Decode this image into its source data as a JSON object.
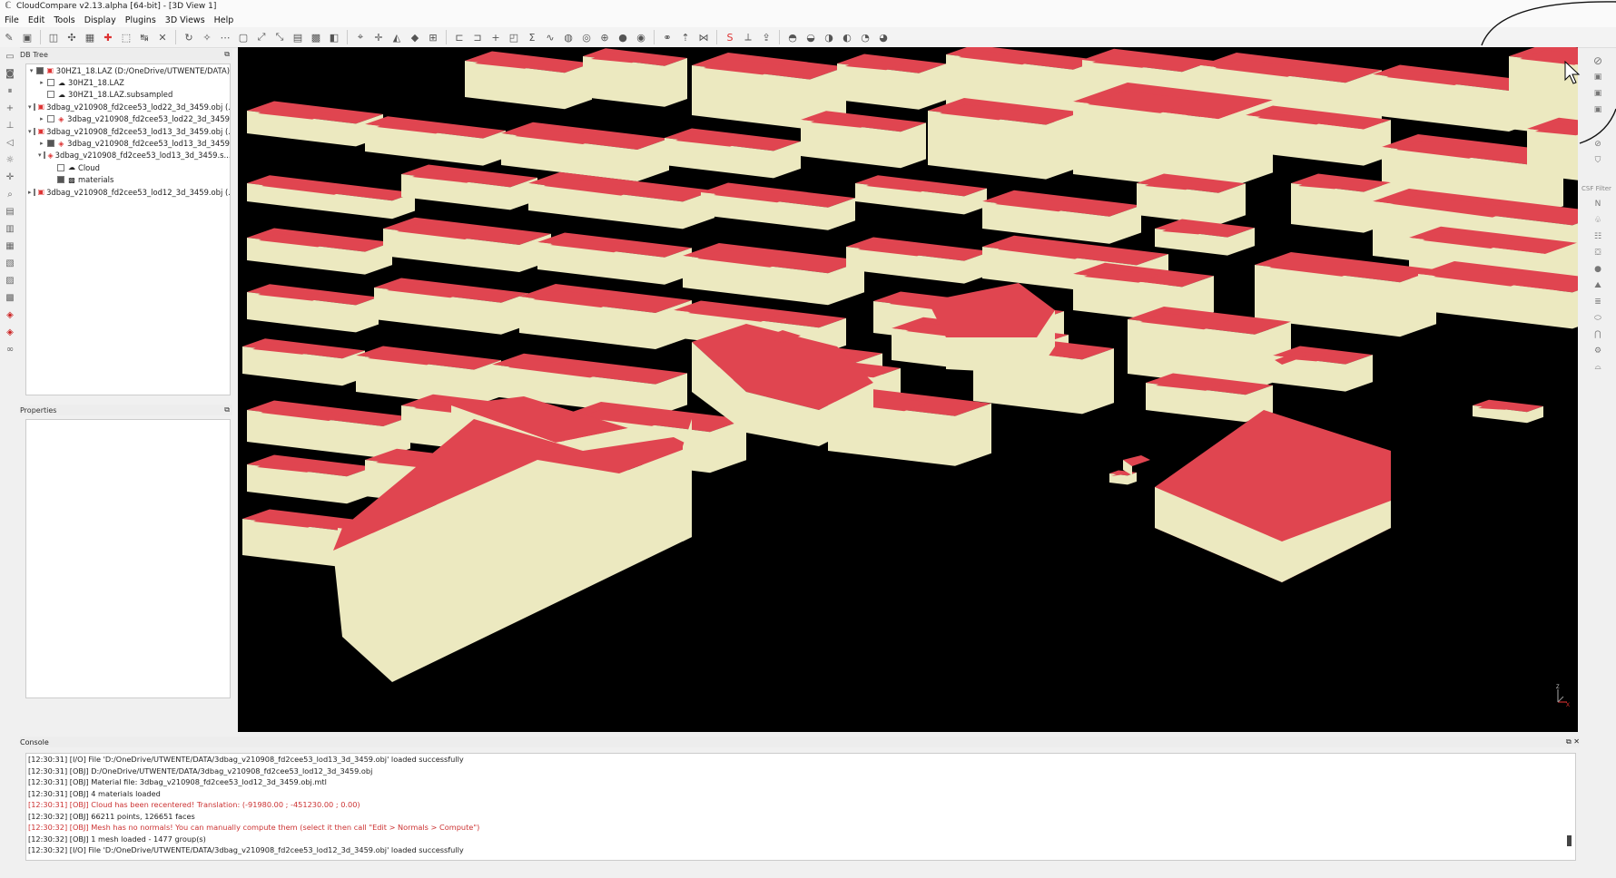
{
  "title": "CloudCompare v2.13.alpha [64-bit] - [3D View 1]",
  "menu": [
    "File",
    "Edit",
    "Tools",
    "Display",
    "Plugins",
    "3D Views",
    "Help"
  ],
  "panels": {
    "dbtree_title": "DB Tree",
    "properties_title": "Properties",
    "console_title": "Console"
  },
  "tree": [
    {
      "indent": 0,
      "arrow": "▾",
      "cb": "on",
      "icon": "folder",
      "label": "30HZ1_18.LAZ (D:/OneDrive/UTWENTE/DATA)"
    },
    {
      "indent": 1,
      "arrow": "▸",
      "cb": "off",
      "icon": "cloud",
      "label": "30HZ1_18.LAZ"
    },
    {
      "indent": 1,
      "arrow": "",
      "cb": "off",
      "icon": "cloud",
      "label": "30HZ1_18.LAZ.subsampled"
    },
    {
      "indent": 0,
      "arrow": "▾",
      "cb": "on",
      "icon": "folder",
      "label": "3dbag_v210908_fd2cee53_lod22_3d_3459.obj (..."
    },
    {
      "indent": 1,
      "arrow": "▸",
      "cb": "off",
      "icon": "mesh",
      "label": "3dbag_v210908_fd2cee53_lod22_3d_3459"
    },
    {
      "indent": 0,
      "arrow": "▾",
      "cb": "on",
      "icon": "folder",
      "label": "3dbag_v210908_fd2cee53_lod13_3d_3459.obj (..."
    },
    {
      "indent": 1,
      "arrow": "▸",
      "cb": "on",
      "icon": "mesh",
      "label": "3dbag_v210908_fd2cee53_lod13_3d_3459"
    },
    {
      "indent": 1,
      "arrow": "▾",
      "cb": "on",
      "icon": "mesh",
      "label": "3dbag_v210908_fd2cee53_lod13_3d_3459.s..."
    },
    {
      "indent": 2,
      "arrow": "",
      "cb": "off",
      "icon": "cloud",
      "label": "Cloud"
    },
    {
      "indent": 2,
      "arrow": "",
      "cb": "on",
      "icon": "materials",
      "label": "materials"
    },
    {
      "indent": 0,
      "arrow": "▸",
      "cb": "on",
      "icon": "folder",
      "label": "3dbag_v210908_fd2cee53_lod12_3d_3459.obj (..."
    }
  ],
  "console": [
    {
      "text": "[12:30:31] [I/O] File 'D:/OneDrive/UTWENTE/DATA/3dbag_v210908_fd2cee53_lod13_3d_3459.obj' loaded successfully",
      "warn": false
    },
    {
      "text": "[12:30:31] [OBJ] D:/OneDrive/UTWENTE/DATA/3dbag_v210908_fd2cee53_lod12_3d_3459.obj",
      "warn": false
    },
    {
      "text": "[12:30:31] [OBJ] Material file: 3dbag_v210908_fd2cee53_lod12_3d_3459.obj.mtl",
      "warn": false
    },
    {
      "text": "[12:30:31] [OBJ] 4 materials loaded",
      "warn": false
    },
    {
      "text": "[12:30:31] [OBJ] Cloud has been recentered! Translation: (-91980.00 ; -451230.00 ; 0.00)",
      "warn": true
    },
    {
      "text": "[12:30:32] [OBJ] 66211 points, 126651 faces",
      "warn": false
    },
    {
      "text": "[12:30:32] [OBJ] Mesh has no normals! You can manually compute them (select it then call \"Edit > Normals > Compute\")",
      "warn": true
    },
    {
      "text": "[12:30:32] [OBJ] 1 mesh loaded - 1477 group(s)",
      "warn": false
    },
    {
      "text": "[12:30:32] [I/O] File 'D:/OneDrive/UTWENTE/DATA/3dbag_v210908_fd2cee53_lod12_3d_3459.obj' loaded successfully",
      "warn": false
    }
  ],
  "right_panel_label": "CSF Filter",
  "colors": {
    "roof": "#e04550",
    "wall": "#ece9c0",
    "background": "#000000"
  }
}
